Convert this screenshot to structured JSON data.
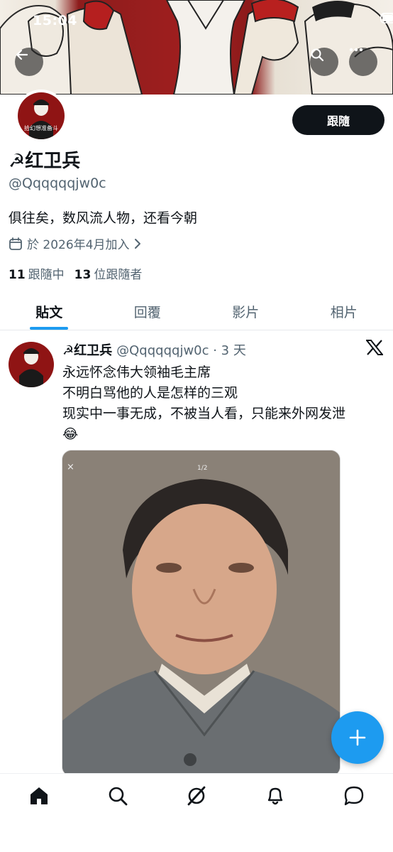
{
  "status_bar": {
    "time": "15:04"
  },
  "profile": {
    "display_name": "☭红卫兵",
    "handle": "@Qqqqqqjw0c",
    "bio": "俱往矣，数风流人物，还看今朝",
    "joined": "於 2026年4月加入",
    "following_count": "11",
    "following_label": "跟隨中",
    "followers_count": "13",
    "followers_label": "位跟隨者",
    "avatar_caption": "拾幻想准备斗"
  },
  "follow_button": {
    "label": "跟隨"
  },
  "tabs": [
    {
      "label": "貼文",
      "active": true
    },
    {
      "label": "回覆",
      "active": false
    },
    {
      "label": "影片",
      "active": false
    },
    {
      "label": "相片",
      "active": false
    }
  ],
  "post": {
    "author": "☭红卫兵",
    "handle_time": "@Qqqqqqjw0c · 3 天",
    "lines": [
      "永远怀念伟大领袖毛主席",
      "不明白骂他的人是怎样的三观",
      "现实中一事无成，不被当人看，只能来外网发泄",
      "😂"
    ],
    "image": {
      "close": "×",
      "counter": "1/2"
    }
  },
  "colors": {
    "accent": "#1d9bf0",
    "text": "#0f1419",
    "muted": "#536471",
    "banner_red": "#9e1f1f"
  },
  "bottom_nav": [
    "home-icon",
    "search-icon",
    "grok-icon",
    "notifications-icon",
    "messages-icon"
  ]
}
